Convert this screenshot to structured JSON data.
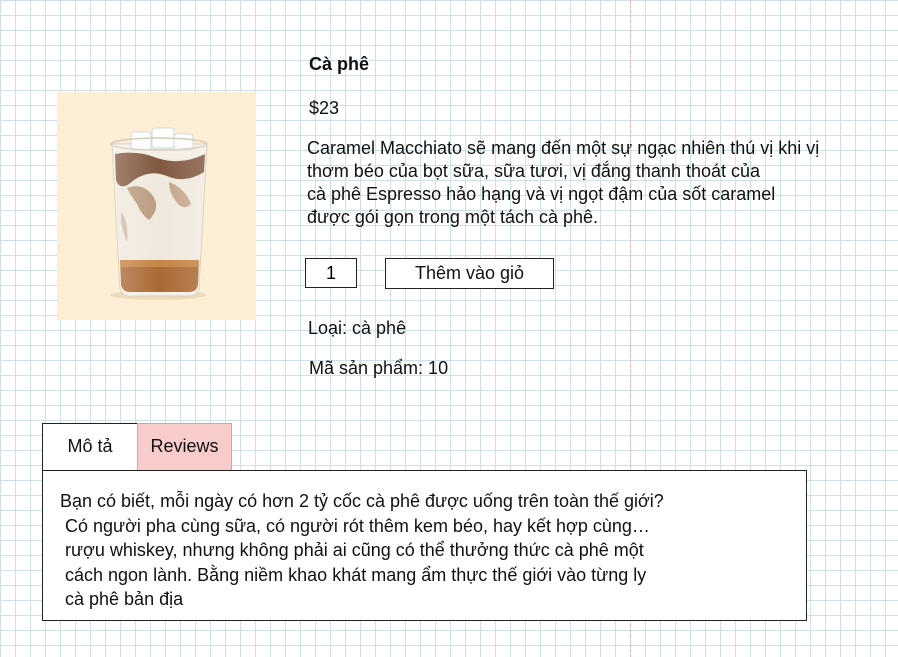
{
  "product": {
    "title": "Cà phê",
    "price": "$23",
    "description": "Caramel Macchiato sẽ mang đến một sự ngạc nhiên thú vị khi vị\nthơm béo của bọt sữa, sữa tươi, vị đắng thanh thoát của\ncà phê Espresso hảo hạng và vị ngọt đậm của sốt caramel\nđược gói gọn trong một tách cà phê.",
    "quantity": "1",
    "add_to_cart_label": "Thêm vào giỏ",
    "category": "Loại: cà phê",
    "sku": "Mã sản phẩm: 10"
  },
  "tabs": {
    "description_label": "Mô tả",
    "reviews_label": "Reviews",
    "active": "reviews",
    "panel_text": "Bạn có biết, mỗi ngày có hơn 2 tỷ cốc cà phê được uống trên toàn thế giới?\n Có người pha cùng sữa, có người rót thêm kem béo, hay kết hợp cùng…\n rượu whiskey, nhưng không phải ai cũng có thể thưởng thức cà phê một\n cách ngon lành. Bằng niềm khao khát mang ẩm thực thế giới vào từng ly\n cà phê bản địa"
  },
  "colors": {
    "image_background": "#fdefd6",
    "active_tab": "#f9cccc",
    "grid_line": "#cfe0ea",
    "margin_line": "#eab3c6"
  }
}
